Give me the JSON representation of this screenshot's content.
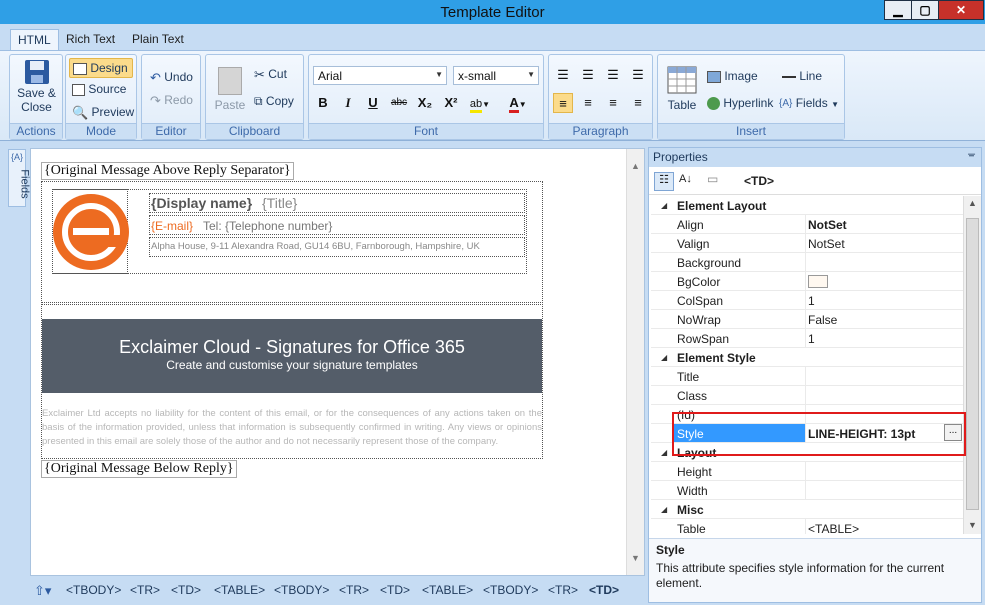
{
  "window": {
    "title": "Template Editor",
    "min": "▁",
    "max": "▢",
    "close": "✕"
  },
  "tabs": [
    "HTML",
    "Rich Text",
    "Plain Text"
  ],
  "ribbon": {
    "actions": {
      "save": "Save &",
      "save2": "Close",
      "label": "Actions"
    },
    "mode": {
      "design": "Design",
      "source": "Source",
      "preview": "Preview",
      "label": "Mode"
    },
    "editor": {
      "undo": "Undo",
      "redo": "Redo",
      "label": "Editor"
    },
    "clipboard": {
      "paste": "Paste",
      "cut": "Cut",
      "copy": "Copy",
      "label": "Clipboard"
    },
    "font": {
      "family": "Arial",
      "size": "x-small",
      "label": "Font",
      "bold": "B",
      "italic": "I",
      "underline": "U",
      "strike": "abc",
      "sub": "X₂",
      "sup": "X²",
      "color": "A"
    },
    "paragraph": {
      "label": "Paragraph"
    },
    "insert": {
      "table": "Table",
      "image": "Image",
      "line": "Line",
      "hyperlink": "Hyperlink",
      "fields": "Fields",
      "label": "Insert"
    }
  },
  "fields_tab": "Fields",
  "editor": {
    "above": "{Original Message Above Reply Separator}",
    "below": "{Original Message Below Reply}",
    "display_name": "{Display name}",
    "title": "{Title}",
    "email": "{E-mail}",
    "tel": "Tel: {Telephone number}",
    "address": "Alpha House, 9-11 Alexandra Road, GU14 6BU, Farnborough, Hampshire, UK",
    "banner_title": "Exclaimer Cloud - Signatures for Office 365",
    "banner_sub": "Create and customise your signature templates",
    "disclaimer": "Exclaimer Ltd accepts no liability for the content of this email, or for the consequences of any actions taken on the basis of the information provided, unless that information is subsequently confirmed in writing. Any views or opinions presented in this email are solely those of the author and do not necessarily represent those of the company."
  },
  "tagbar": [
    "<TBODY>",
    "<TR>",
    "<TD>",
    "<TABLE>",
    "<TBODY>",
    "<TR>",
    "<TD>",
    "<TABLE>",
    "<TBODY>",
    "<TR>",
    "<TD>"
  ],
  "properties": {
    "title": "Properties",
    "pin": "ᚚ",
    "element": "<TD>",
    "rows": [
      {
        "k": "Element Layout",
        "v": "",
        "cat": true
      },
      {
        "k": "Align",
        "v": "NotSet"
      },
      {
        "k": "Valign",
        "v": "NotSet"
      },
      {
        "k": "Background",
        "v": ""
      },
      {
        "k": "BgColor",
        "v": ""
      },
      {
        "k": "ColSpan",
        "v": "1"
      },
      {
        "k": "NoWrap",
        "v": "False"
      },
      {
        "k": "RowSpan",
        "v": "1"
      },
      {
        "k": "Element Style",
        "v": "",
        "cat": true
      },
      {
        "k": "Title",
        "v": ""
      },
      {
        "k": "Class",
        "v": ""
      },
      {
        "k": "(Id)",
        "v": ""
      },
      {
        "k": "Style",
        "v": "LINE-HEIGHT: 13pt",
        "sel": true
      },
      {
        "k": "Layout",
        "v": "",
        "cat": true
      },
      {
        "k": "Height",
        "v": ""
      },
      {
        "k": "Width",
        "v": ""
      },
      {
        "k": "Misc",
        "v": "",
        "cat": true
      },
      {
        "k": "Table",
        "v": "<TABLE>",
        "cat2": true
      }
    ],
    "desc_title": "Style",
    "desc_text": "This attribute specifies style information for the current element."
  }
}
